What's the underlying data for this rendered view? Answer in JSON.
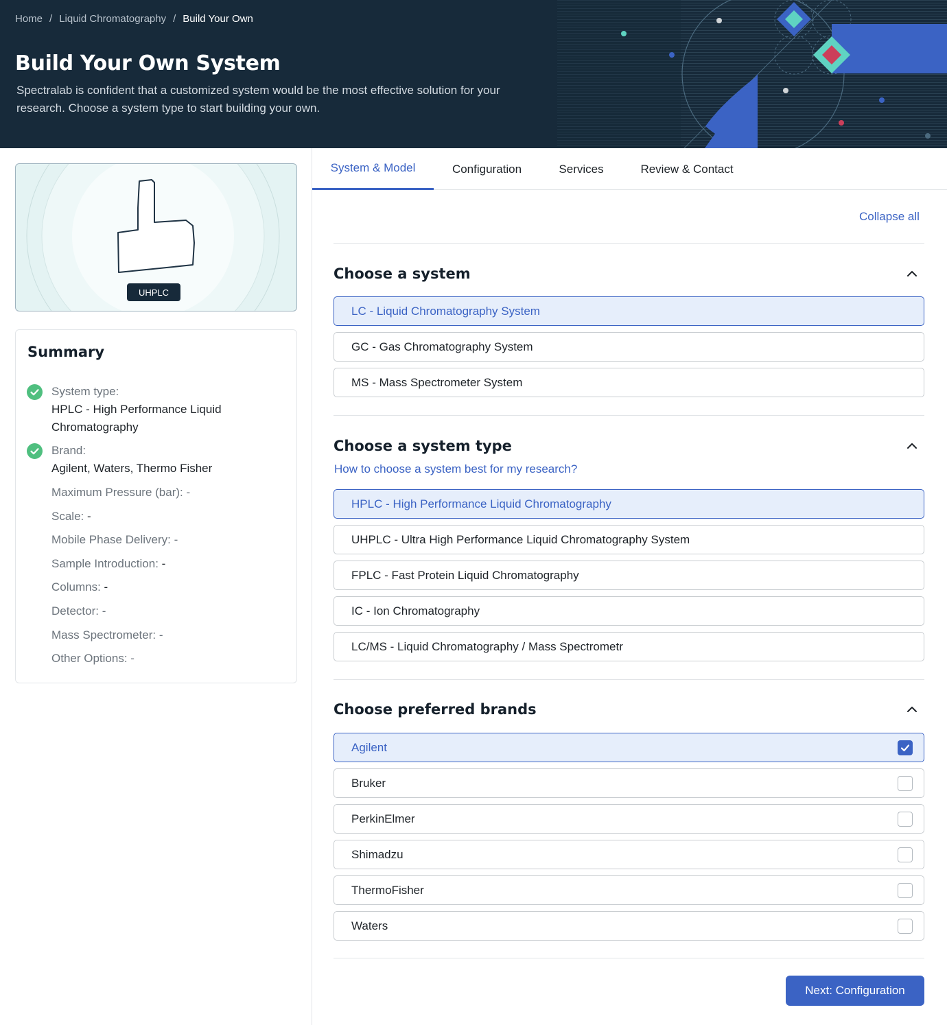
{
  "breadcrumb": {
    "home": "Home",
    "parent": "Liquid Chromatography",
    "current": "Build Your Own"
  },
  "hero": {
    "title": "Build Your Own System",
    "description": "Spectralab is confident that a customized system would be the most effective solution for your research. Choose a system type to start building your own."
  },
  "preview": {
    "badge": "UHPLC"
  },
  "summary": {
    "title": "Summary",
    "system_type_label": "System type:",
    "system_type_value": "HPLC - High Performance Liquid Chromatography",
    "brand_label": "Brand:",
    "brand_value": "Agilent, Waters, Thermo Fisher",
    "max_pressure_label": "Maximum Pressure (bar):",
    "max_pressure_value": "-",
    "scale_label": "Scale:",
    "scale_value": "-",
    "mobile_phase_label": "Mobile Phase Delivery:",
    "mobile_phase_value": "-",
    "sample_intro_label": "Sample Introduction:",
    "sample_intro_value": "-",
    "columns_label": "Columns:",
    "columns_value": "-",
    "detector_label": "Detector:",
    "detector_value": "-",
    "mass_spec_label": "Mass Spectrometer:",
    "mass_spec_value": "-",
    "other_label": "Other Options:",
    "other_value": "-"
  },
  "tabs": [
    {
      "label": "System & Model",
      "active": true
    },
    {
      "label": "Configuration",
      "active": false
    },
    {
      "label": "Services",
      "active": false
    },
    {
      "label": "Review & Contact",
      "active": false
    }
  ],
  "collapse_all": "Collapse all",
  "section_system": {
    "title": "Choose a system",
    "options": [
      {
        "label": "LC - Liquid Chromatography System",
        "selected": true
      },
      {
        "label": "GC - Gas Chromatography System",
        "selected": false
      },
      {
        "label": "MS - Mass Spectrometer System",
        "selected": false
      }
    ]
  },
  "section_type": {
    "title": "Choose a system type",
    "help_link": "How to choose a system best for my research?",
    "options": [
      {
        "label": "HPLC - High Performance Liquid Chromatography",
        "selected": true
      },
      {
        "label": "UHPLC - Ultra High Performance Liquid Chromatography System",
        "selected": false
      },
      {
        "label": "FPLC - Fast Protein Liquid Chromatography",
        "selected": false
      },
      {
        "label": "IC - Ion Chromatography",
        "selected": false
      },
      {
        "label": "LC/MS - Liquid Chromatography / Mass Spectrometr",
        "selected": false
      }
    ]
  },
  "section_brands": {
    "title": "Choose preferred brands",
    "options": [
      {
        "label": "Agilent",
        "checked": true
      },
      {
        "label": "Bruker",
        "checked": false
      },
      {
        "label": "PerkinElmer",
        "checked": false
      },
      {
        "label": "Shimadzu",
        "checked": false
      },
      {
        "label": "ThermoFisher",
        "checked": false
      },
      {
        "label": "Waters",
        "checked": false
      }
    ]
  },
  "next_button": "Next: Configuration",
  "colors": {
    "primary": "#3b63c4",
    "header_bg": "#172a3a",
    "success": "#4fbf7f",
    "selected_bg": "#e6eefb"
  }
}
